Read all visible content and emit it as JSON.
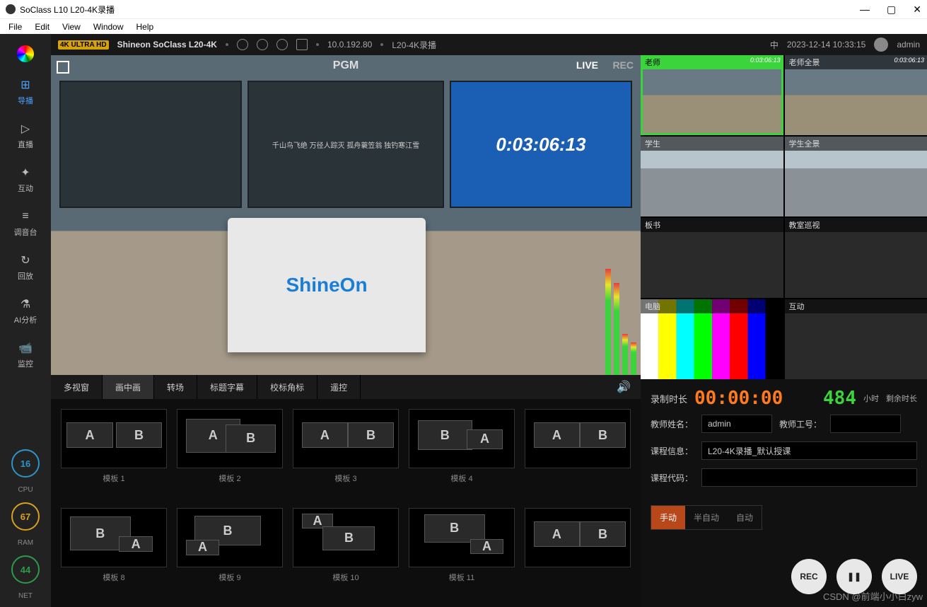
{
  "window": {
    "title": "SoClass L10 L20-4K录播"
  },
  "menu": [
    "File",
    "Edit",
    "View",
    "Window",
    "Help"
  ],
  "topbar": {
    "badge": "4K ULTRA HD",
    "brand": "Shineon SoClass L20-4K",
    "ip": "10.0.192.80",
    "mode": "L20-4K录播",
    "ime": "中",
    "datetime": "2023-12-14 10:33:15",
    "user": "admin"
  },
  "sidenav": {
    "items": [
      {
        "label": "导播",
        "icon": "⊞",
        "active": true
      },
      {
        "label": "直播",
        "icon": "▷"
      },
      {
        "label": "互动",
        "icon": "✦"
      },
      {
        "label": "调音台",
        "icon": "≡"
      },
      {
        "label": "回放",
        "icon": "↻"
      },
      {
        "label": "AI分析",
        "icon": "⚗"
      },
      {
        "label": "监控",
        "icon": "📹"
      }
    ],
    "gauges": {
      "cpu": "16",
      "cpu_lbl": "CPU",
      "ram": "67",
      "ram_lbl": "RAM",
      "net": "44",
      "net_lbl": "NET"
    }
  },
  "pgm": {
    "label": "PGM",
    "live": "LIVE",
    "rec": "REC",
    "board_text": "千山鸟飞绝 万径人踪灭\n孤舟蓑笠翁 独钓寒江雪",
    "tv_timer": "0:03:06:13",
    "podium_brand": "ShineOn"
  },
  "tabs": [
    "多视窗",
    "画中画",
    "转场",
    "标题字幕",
    "校标角标",
    "遥控"
  ],
  "templates": [
    {
      "label": "模板 1"
    },
    {
      "label": "模板 2"
    },
    {
      "label": "模板 3"
    },
    {
      "label": "模板 4"
    },
    {
      "label": ""
    },
    {
      "label": "模板 8"
    },
    {
      "label": "模板 9"
    },
    {
      "label": "模板 10"
    },
    {
      "label": "模板 11"
    },
    {
      "label": ""
    }
  ],
  "previews": [
    {
      "label": "老师",
      "time": "0:03:06:13",
      "cls": "pv-room",
      "sel": true
    },
    {
      "label": "老师全景",
      "time": "0:03:06:13",
      "cls": "pv-room"
    },
    {
      "label": "学生",
      "cls": "pv-stud"
    },
    {
      "label": "学生全景",
      "cls": "pv-stud"
    },
    {
      "label": "板书",
      "cls": ""
    },
    {
      "label": "教室巡视",
      "cls": ""
    },
    {
      "label": "电脑",
      "cls": "pv-bars"
    },
    {
      "label": "互动",
      "cls": ""
    }
  ],
  "rec": {
    "dur_lbl": "录制时长",
    "dur": "00:00:00",
    "rem": "484",
    "rem_unit": "小时",
    "rem_lbl": "剩余时长"
  },
  "form": {
    "teacher_lbl": "教师姓名：",
    "teacher": "admin",
    "teacher_id_lbl": "教师工号：",
    "course_lbl": "课程信息：",
    "course": "L20-4K录播_默认授课",
    "code_lbl": "课程代码："
  },
  "modes": [
    "手动",
    "半自动",
    "自动"
  ],
  "buttons": {
    "rec": "REC",
    "pause": "❚❚",
    "live": "LIVE"
  },
  "watermark": "CSDN @前端小小白zyw"
}
